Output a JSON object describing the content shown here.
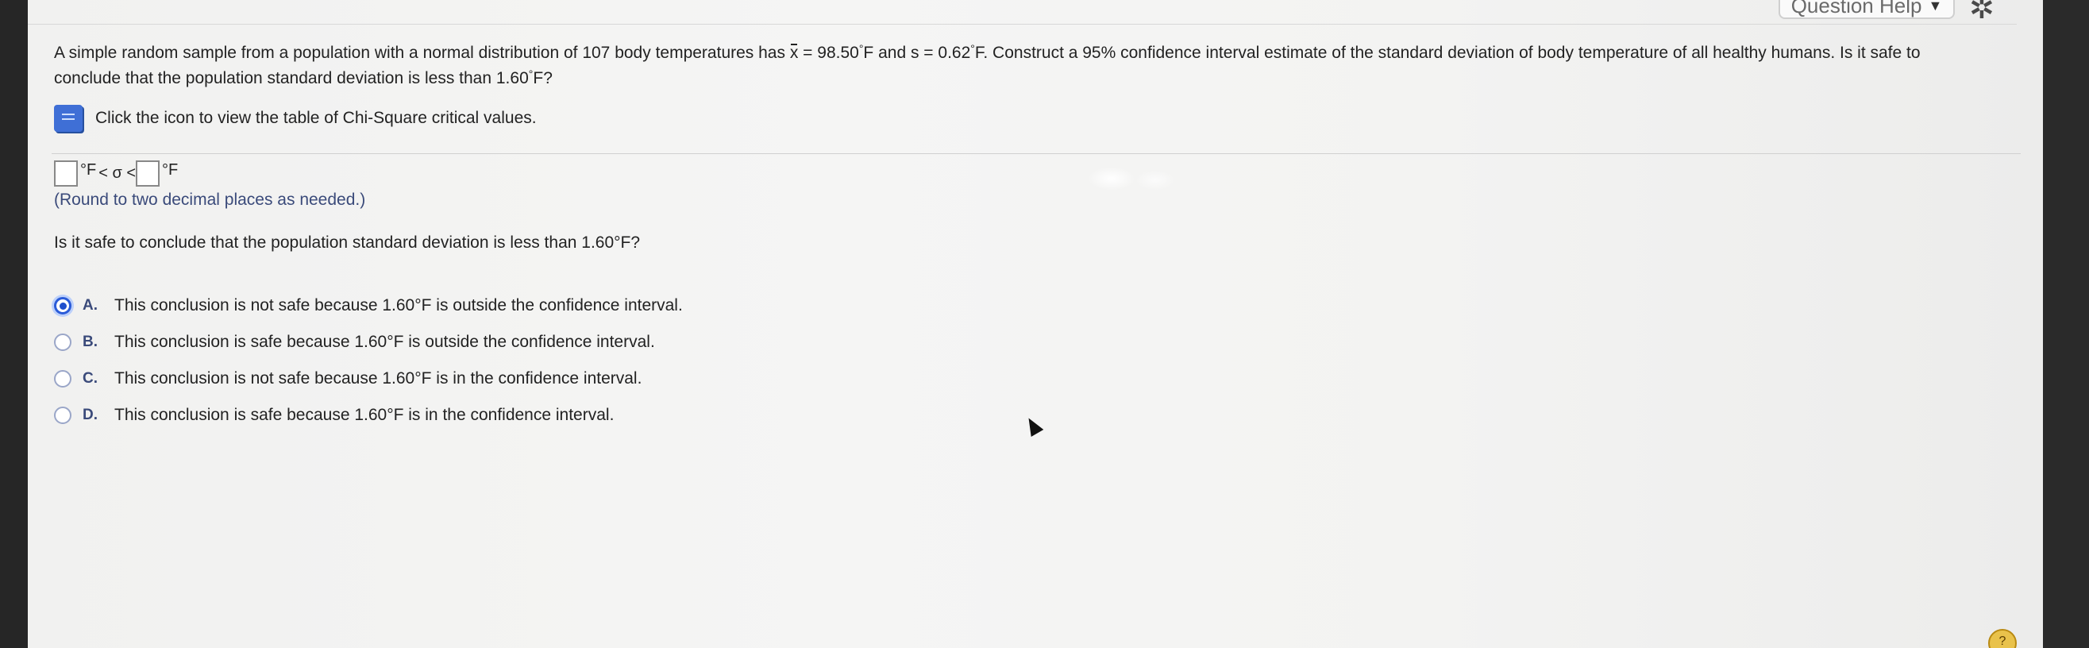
{
  "header": {
    "help_label": "Question Help",
    "help_caret": "▼",
    "settings_icon": "gear-icon"
  },
  "question": {
    "text_1": "A simple random sample from a population with a normal distribution of 107 body temperatures has ",
    "xbar_symbol": "x",
    "text_2": " = 98.50",
    "deg_1": "°",
    "text_3": "F and s = 0.62",
    "deg_2": "°",
    "text_4": "F. Construct a 95% confidence interval estimate of the standard deviation of body temperature of all healthy humans. Is it safe to conclude that the population standard deviation is less than 1.60",
    "deg_3": "°",
    "text_5": "F?"
  },
  "info": {
    "icon": "book-icon",
    "text": "Click the icon to view the table of Chi-Square critical values."
  },
  "interval": {
    "lower_value": "",
    "upper_value": "",
    "unit_1": "°F",
    "middle": " < σ < ",
    "unit_2": "°F"
  },
  "round_note": "(Round to two decimal places as needed.)",
  "question2": "Is it safe to conclude that the population standard deviation is less than 1.60°F?",
  "options": [
    {
      "letter": "A.",
      "text": "This conclusion is not safe because 1.60°F is outside the confidence interval.",
      "selected": true
    },
    {
      "letter": "B.",
      "text": "This conclusion is safe because 1.60°F is outside the confidence interval.",
      "selected": false
    },
    {
      "letter": "C.",
      "text": "This conclusion is not safe because 1.60°F is in the confidence interval.",
      "selected": false
    },
    {
      "letter": "D.",
      "text": "This conclusion is safe because 1.60°F is in the confidence interval.",
      "selected": false
    }
  ],
  "corner_badge": "?"
}
